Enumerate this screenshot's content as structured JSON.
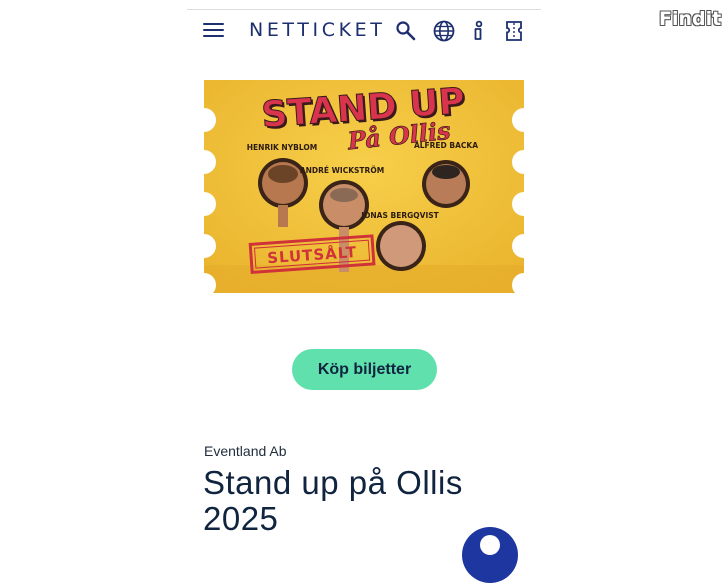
{
  "header": {
    "logo": "NETTICKET",
    "icons": [
      "menu-icon",
      "search-icon",
      "globe-icon",
      "info-icon",
      "ticket-icon"
    ]
  },
  "event_image": {
    "title_line1": "STAND UP",
    "title_line2": "På Ollis",
    "performers": [
      "HENRIK NYBLOM",
      "ANDRÉ WICKSTRÖM",
      "ALFRED BACKA",
      "JONAS BERGQVIST"
    ],
    "stamp": "SLUTSÅLT"
  },
  "cta": {
    "label": "Köp biljetter"
  },
  "event": {
    "organizer": "Eventland Ab",
    "title": "Stand up på Ollis 2025"
  },
  "watermark": "Findit",
  "colors": {
    "brand": "#1d2f6f",
    "button": "#5fe0ad",
    "poster": "#f1c23c",
    "poster_title": "#d8344d",
    "stamp": "#d0323a",
    "fab": "#1e37a0"
  }
}
